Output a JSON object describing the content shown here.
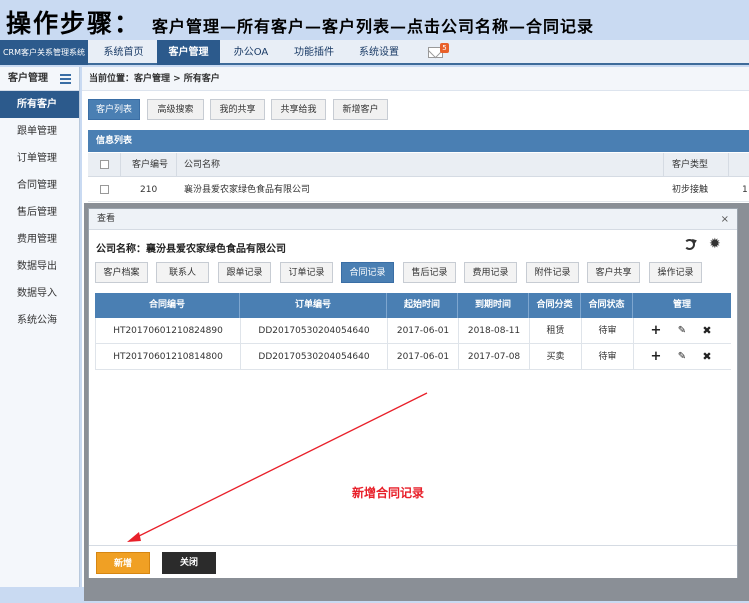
{
  "banner": {
    "title": "操作步骤：",
    "steps": "客户管理—所有客户—客户列表—点击公司名称—合同记录"
  },
  "topnav": {
    "brand": "CRM客户关系管理系统",
    "items": [
      "系统首页",
      "客户管理",
      "办公OA",
      "功能插件",
      "系统设置"
    ],
    "active_index": 1,
    "mail_badge": "5"
  },
  "sidebar": {
    "header": "客户管理",
    "items": [
      "所有客户",
      "跟单管理",
      "订单管理",
      "合同管理",
      "售后管理",
      "费用管理",
      "数据导出",
      "数据导入",
      "系统公海"
    ],
    "active_index": 0
  },
  "main": {
    "breadcrumb": "当前位置：客户管理 > 所有客户",
    "tabs": [
      "客户列表",
      "高级搜索",
      "我的共享",
      "共享给我",
      "新增客户"
    ],
    "active_tab": 0,
    "info_header": "信息列表",
    "table": {
      "headers": [
        "客户编号",
        "公司名称",
        "客户类型"
      ],
      "rows": [
        {
          "id": "210",
          "company": "襄汾县爱农家绿色食品有限公司",
          "type": "初步接触",
          "extra": "1"
        }
      ],
      "extra_col": "1"
    }
  },
  "modal": {
    "title": "查看",
    "close": "×",
    "company_label": "公司名称：襄汾县爱农家绿色食品有限公司",
    "tabs": [
      "客户档案",
      "联系人",
      "跟单记录",
      "订单记录",
      "合同记录",
      "售后记录",
      "费用记录",
      "附件记录",
      "客户共享",
      "操作记录"
    ],
    "active_tab": 4,
    "grid": {
      "headers": [
        "合同编号",
        "订单编号",
        "起始时间",
        "到期时间",
        "合同分类",
        "合同状态",
        "管理"
      ],
      "rows": [
        {
          "contract_no": "HT20170601210824890",
          "order_no": "DD20170530204054640",
          "start": "2017-06-01",
          "end": "2018-08-11",
          "category": "租赁",
          "status": "待审"
        },
        {
          "contract_no": "HT20170601210814800",
          "order_no": "DD20170530204054640",
          "start": "2017-06-01",
          "end": "2017-07-08",
          "category": "买卖",
          "status": "待审"
        }
      ]
    },
    "annotation": "新增合同记录",
    "buttons": {
      "new": "新增",
      "close": "关闭"
    }
  },
  "colors": {
    "primary": "#2c5a8c",
    "tab_active": "#4a7fb3",
    "new_button": "#f0a024",
    "annotation": "#e8202a"
  }
}
